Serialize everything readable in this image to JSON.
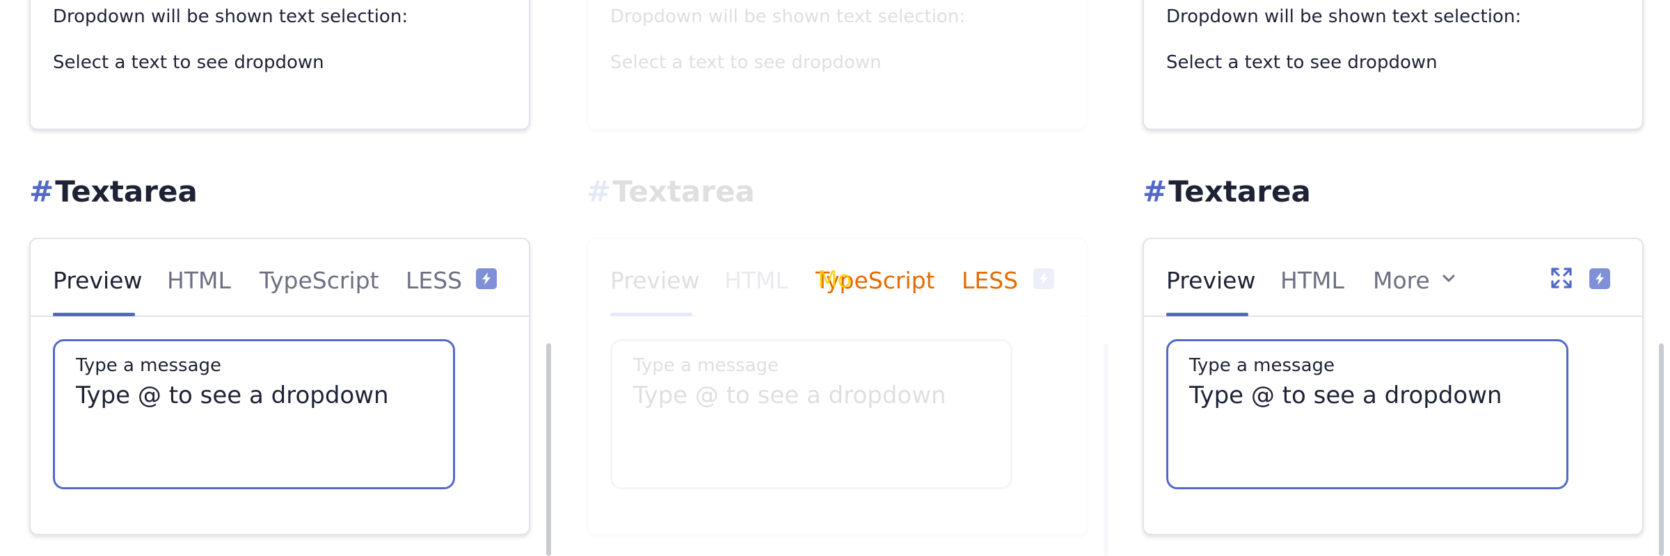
{
  "panels": [
    {
      "top_card": {
        "line1": "Dropdown will be shown text selection:",
        "line2": "Select a text to see dropdown"
      },
      "heading": {
        "hash": "#",
        "text": "Textarea"
      },
      "tabs": [
        "Preview",
        "HTML",
        "TypeScript",
        "LESS"
      ],
      "active_tab": "Preview",
      "field": {
        "label": "Type a message",
        "value": "Type @ to see a dropdown"
      }
    },
    {
      "top_card": {
        "line1": "Dropdown will be shown text selection:",
        "line2": "Select a text to see dropdown"
      },
      "heading": {
        "hash": "#",
        "text": "Textarea"
      },
      "tabs": [
        "Preview",
        "HTML",
        "TypeScript",
        "LESS"
      ],
      "active_tab": "Preview",
      "field": {
        "label": "Type a message",
        "value": "Type @ to see a dropdown"
      }
    },
    {
      "top_card": {
        "line1": "Dropdown will be shown text selection:",
        "line2": "Select a text to see dropdown"
      },
      "heading": {
        "hash": "#",
        "text": "Textarea"
      },
      "tabs": [
        "Preview",
        "HTML",
        "More"
      ],
      "active_tab": "Preview",
      "field": {
        "label": "Type a message",
        "value": "Type @ to see a dropdown"
      }
    }
  ],
  "icons": {
    "bolt": "lightning-icon",
    "expand": "expand-icon",
    "chevron": "chevron-down-icon"
  },
  "colors": {
    "accent": "#5269c9",
    "text": "#1e2235",
    "muted": "#6d7084",
    "border": "#e3e4ea",
    "glitch_a": "#e66b00",
    "glitch_b": "#ffd000"
  }
}
